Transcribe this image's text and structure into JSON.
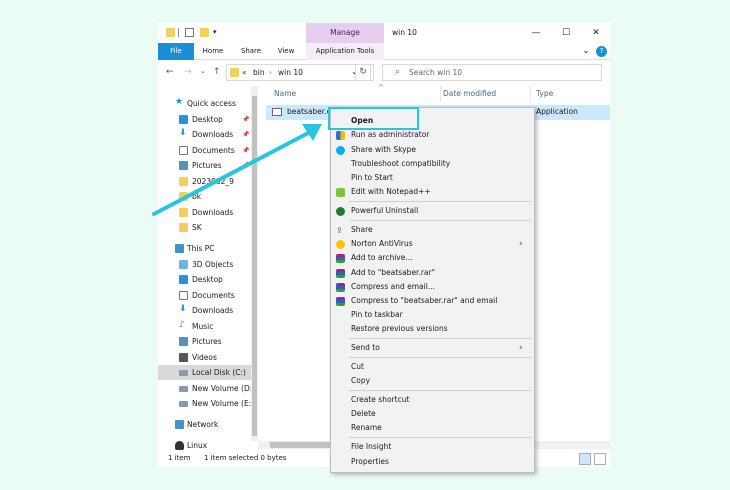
{
  "window": {
    "title": "win 10",
    "manage_label": "Manage",
    "controls": {
      "minimize": "—",
      "maximize": "☐",
      "close": "✕"
    }
  },
  "ribbon": {
    "tabs": [
      {
        "label": "File"
      },
      {
        "label": "Home"
      },
      {
        "label": "Share"
      },
      {
        "label": "View"
      },
      {
        "label": "Application Tools"
      }
    ],
    "collapse_glyph": "⌄",
    "help_glyph": "?"
  },
  "address": {
    "back": "←",
    "forward": "→",
    "recent": "⌄",
    "up": "↑",
    "crumb_overflow": "«",
    "crumbs": [
      "bin",
      "win 10"
    ],
    "dropdown": "⌄",
    "refresh": "↻",
    "search_placeholder": "Search win 10"
  },
  "nav": {
    "items": [
      {
        "label": "Quick access",
        "icon": "star-icon",
        "pinned": false
      },
      {
        "label": "Desktop",
        "icon": "desktop-icon",
        "pinned": true
      },
      {
        "label": "Downloads",
        "icon": "download-icon",
        "pinned": true
      },
      {
        "label": "Documents",
        "icon": "documents-icon",
        "pinned": true
      },
      {
        "label": "Pictures",
        "icon": "pictures-icon",
        "pinned": true
      },
      {
        "label": "2023082_9",
        "icon": "folder-icon",
        "pinned": false
      },
      {
        "label": "bk",
        "icon": "folder-icon",
        "pinned": false
      },
      {
        "label": "Downloads",
        "icon": "folder-icon",
        "pinned": false
      },
      {
        "label": "SK",
        "icon": "folder-icon",
        "pinned": false
      },
      {
        "label": "This PC",
        "icon": "pc-icon",
        "pinned": false
      },
      {
        "label": "3D Objects",
        "icon": "3d-objects-icon",
        "pinned": false
      },
      {
        "label": "Desktop",
        "icon": "desktop-icon",
        "pinned": false
      },
      {
        "label": "Documents",
        "icon": "documents-icon",
        "pinned": false
      },
      {
        "label": "Downloads",
        "icon": "download-icon",
        "pinned": false
      },
      {
        "label": "Music",
        "icon": "music-icon",
        "pinned": false
      },
      {
        "label": "Pictures",
        "icon": "pictures-icon",
        "pinned": false
      },
      {
        "label": "Videos",
        "icon": "videos-icon",
        "pinned": false
      },
      {
        "label": "Local Disk (C:)",
        "icon": "disk-icon",
        "pinned": false
      },
      {
        "label": "New Volume (D:)",
        "icon": "disk-icon",
        "pinned": false
      },
      {
        "label": "New Volume (E:)",
        "icon": "disk-icon",
        "pinned": false
      },
      {
        "label": "Network",
        "icon": "network-icon",
        "pinned": false
      },
      {
        "label": "Linux",
        "icon": "linux-icon",
        "pinned": false
      }
    ],
    "pin_glyph": "📌"
  },
  "list": {
    "headers": [
      "Name",
      "Date modified",
      "Type"
    ],
    "sort_glyph": "^",
    "file": {
      "name": "beatsaber.e",
      "type": "Application"
    }
  },
  "status": {
    "count": "1 item",
    "selected": "1 item selected  0 bytes"
  },
  "context_menu": {
    "items": [
      {
        "label": "Open",
        "icon": ""
      },
      {
        "label": "Run as administrator",
        "icon": "shield-icon"
      },
      {
        "label": "Share with Skype",
        "icon": "skype-icon"
      },
      {
        "label": "Troubleshoot compatibility",
        "icon": ""
      },
      {
        "label": "Pin to Start",
        "icon": ""
      },
      {
        "label": "Edit with Notepad++",
        "icon": "notepad-plus-icon"
      },
      {
        "label": "Powerful Uninstall",
        "icon": "uninstall-icon"
      },
      {
        "label": "Share",
        "icon": "share-icon"
      },
      {
        "label": "Norton AntiVirus",
        "icon": "norton-icon"
      },
      {
        "label": "Add to archive...",
        "icon": "winrar-icon"
      },
      {
        "label": "Add to \"beatsaber.rar\"",
        "icon": "winrar-icon"
      },
      {
        "label": "Compress and email...",
        "icon": "winrar-icon"
      },
      {
        "label": "Compress to \"beatsaber.rar\" and email",
        "icon": "winrar-icon"
      },
      {
        "label": "Pin to taskbar",
        "icon": ""
      },
      {
        "label": "Restore previous versions",
        "icon": ""
      },
      {
        "label": "Send to",
        "icon": ""
      },
      {
        "label": "Cut",
        "icon": ""
      },
      {
        "label": "Copy",
        "icon": ""
      },
      {
        "label": "Create shortcut",
        "icon": ""
      },
      {
        "label": "Delete",
        "icon": ""
      },
      {
        "label": "Rename",
        "icon": ""
      },
      {
        "label": "File Insight",
        "icon": ""
      },
      {
        "label": "Properties",
        "icon": ""
      }
    ],
    "submenu_glyph": "›"
  },
  "colors": {
    "file_tab": "#1a8fd6",
    "manage_tab": "#e6cef0",
    "selection": "#cce8ff",
    "highlight": "#29c4dd",
    "folder": "#f3cf5f"
  }
}
